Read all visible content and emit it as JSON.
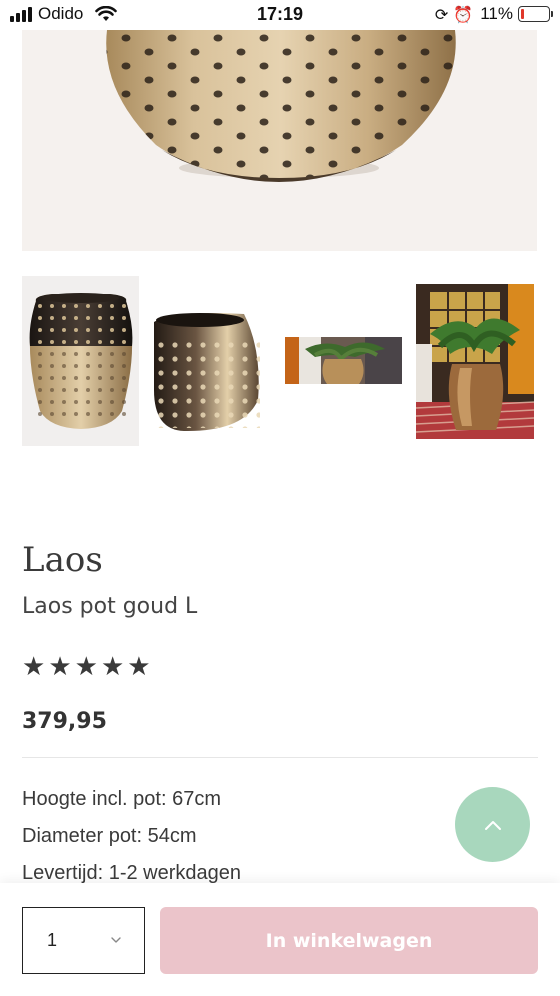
{
  "status_bar": {
    "carrier": "Odido",
    "time": "17:19",
    "battery_percent": "11%",
    "battery_level": 0.11,
    "icons": [
      "signal-icon",
      "wifi-icon",
      "orientation-lock-icon",
      "alarm-icon",
      "battery-icon"
    ]
  },
  "gallery": {
    "thumbnail_count": 4
  },
  "product": {
    "title": "Laos",
    "subtitle": "Laos pot goud L",
    "rating_stars": 5,
    "price": "379,95",
    "specs": [
      "Hoogte incl. pot: 67cm",
      "Diameter pot: 54cm",
      "Levertijd: 1-2 werkdagen"
    ]
  },
  "scroll_top": {
    "icon": "chevron-up-icon"
  },
  "cart": {
    "quantity": "1",
    "button_label": "In winkelwagen"
  },
  "colors": {
    "accent_button": "#ebc4ca",
    "scroll_top_button": "#a8d7bd",
    "text": "#333333",
    "battery_low": "#e0372a"
  }
}
